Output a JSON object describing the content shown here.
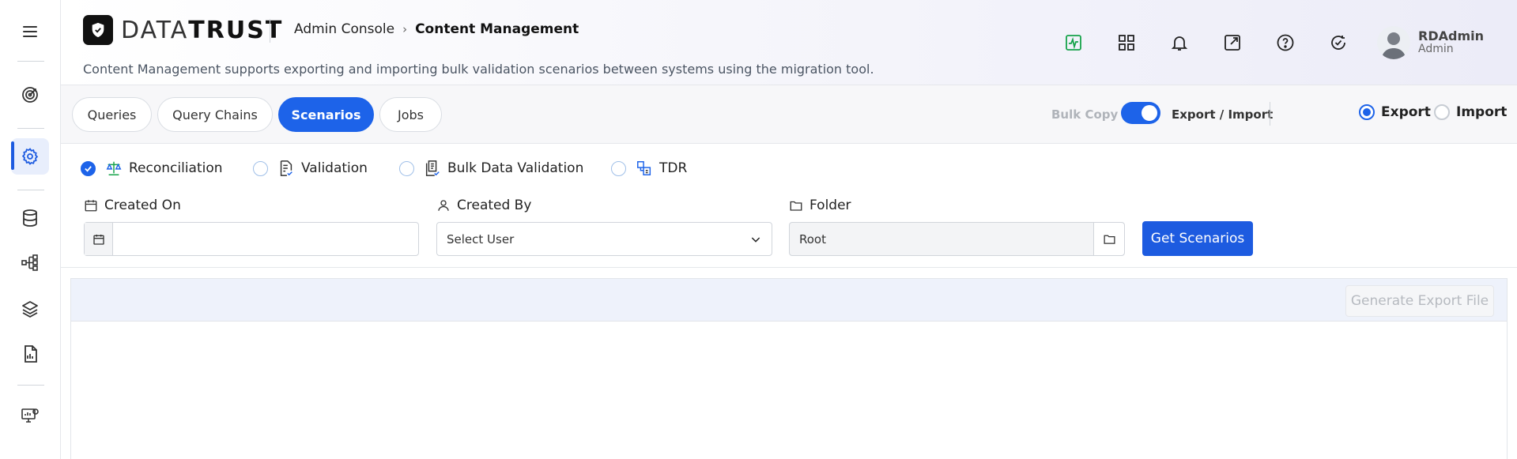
{
  "brand": {
    "logo_text_light": "DATA",
    "logo_text_bold": "TRUST"
  },
  "breadcrumb": {
    "root": "Admin Console",
    "current": "Content Management"
  },
  "description": "Content Management supports exporting and importing bulk validation scenarios between systems using the migration tool.",
  "user": {
    "name": "RDAdmin",
    "role": "Admin"
  },
  "sidebar": {
    "items": [
      "menu-icon",
      "target-icon",
      "settings-icon",
      "database-icon",
      "workflow-icon",
      "layers-icon",
      "report-icon",
      "monitor-icon"
    ],
    "active": "settings-icon"
  },
  "header_icons": [
    "activity-icon",
    "grid-icon",
    "bell-icon",
    "external-link-icon",
    "help-icon",
    "refresh-check-icon"
  ],
  "tabs": [
    {
      "label": "Queries",
      "active": false
    },
    {
      "label": "Query Chains",
      "active": false
    },
    {
      "label": "Scenarios",
      "active": true
    },
    {
      "label": "Jobs",
      "active": false
    }
  ],
  "bulk_copy": {
    "label": "Bulk Copy",
    "toggle_label": "Export / Import",
    "toggle_on": true
  },
  "mode": {
    "export_label": "Export",
    "import_label": "Import",
    "selected": "Export"
  },
  "scenario_types": [
    {
      "label": "Reconciliation",
      "checked": true
    },
    {
      "label": "Validation",
      "checked": false
    },
    {
      "label": "Bulk Data Validation",
      "checked": false
    },
    {
      "label": "TDR",
      "checked": false
    }
  ],
  "filters": {
    "created_on_label": "Created On",
    "created_on_value": "",
    "created_by_label": "Created By",
    "created_by_value": "Select User",
    "folder_label": "Folder",
    "folder_value": "Root"
  },
  "buttons": {
    "get_scenarios": "Get Scenarios",
    "generate_export": "Generate Export File"
  },
  "colors": {
    "primary": "#1d63e9",
    "accent_green": "#16a34a"
  }
}
